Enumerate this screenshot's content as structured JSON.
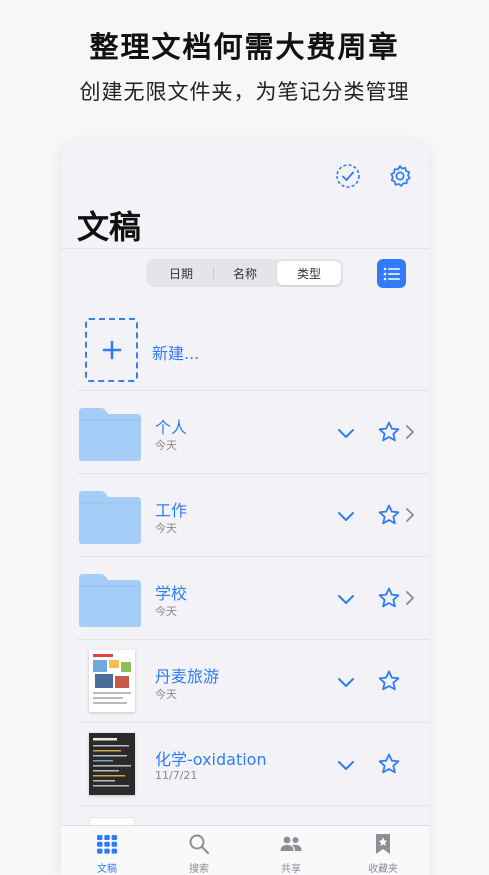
{
  "promo": {
    "title": "整理文档何需大费周章",
    "subtitle": "创建无限文件夹，为笔记分类管理"
  },
  "header": {
    "title": "文稿",
    "sort_tabs": [
      {
        "label": "日期",
        "active": false
      },
      {
        "label": "名称",
        "active": false
      },
      {
        "label": "类型",
        "active": true
      }
    ]
  },
  "new_item": {
    "label": "新建..."
  },
  "documents": [
    {
      "name": "个人",
      "date": "今天",
      "kind": "folder",
      "starred": false
    },
    {
      "name": "工作",
      "date": "今天",
      "kind": "folder",
      "starred": false
    },
    {
      "name": "学校",
      "date": "今天",
      "kind": "folder",
      "starred": false
    },
    {
      "name": "丹麦旅游",
      "date": "今天",
      "kind": "document",
      "starred": false
    },
    {
      "name": "化学-oxidation",
      "date": "11/7/21",
      "kind": "document",
      "starred": false
    }
  ],
  "tabbar": {
    "tabs": [
      {
        "label": "文稿",
        "icon": "grid-icon",
        "active": true
      },
      {
        "label": "搜索",
        "icon": "search-icon",
        "active": false
      },
      {
        "label": "共享",
        "icon": "people-icon",
        "active": false
      },
      {
        "label": "收藏夹",
        "icon": "bookmark-star-icon",
        "active": false
      }
    ]
  },
  "colors": {
    "accent": "#2f7cf6",
    "folder": "#a6cdf7",
    "background": "#f2f2f7"
  }
}
